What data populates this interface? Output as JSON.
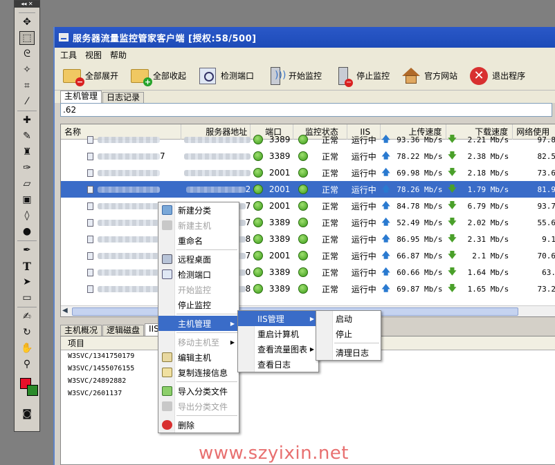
{
  "window": {
    "title": "服务器流量监控管家客户端 [授权:58/500]"
  },
  "menu": {
    "tools": "工具",
    "view": "视图",
    "help": "帮助"
  },
  "toolbar": {
    "expand_all": "全部展开",
    "collapse_all": "全部收起",
    "check_port": "检测端口",
    "start_monitor": "开始监控",
    "stop_monitor": "停止监控",
    "official_site": "官方网站",
    "exit": "退出程序"
  },
  "tabs": {
    "hosts": "主机管理",
    "logs": "日志记录"
  },
  "search": {
    "value": ".62"
  },
  "grid": {
    "columns": [
      "名称",
      "服务器地址",
      "端口",
      "监控状态",
      "IIS",
      "上传速度",
      "下载速度",
      "网络使用"
    ],
    "rows": [
      {
        "name_suffix": "",
        "addr_suffix": "",
        "port": "3389",
        "status": "正常",
        "iis": "运行中",
        "up": "93.36 Mb/s",
        "down": "2.21 Mb/s",
        "net": "97.8"
      },
      {
        "name_suffix": "7",
        "addr_suffix": "",
        "port": "3389",
        "status": "正常",
        "iis": "运行中",
        "up": "78.22 Mb/s",
        "down": "2.38 Mb/s",
        "net": "82.5"
      },
      {
        "name_suffix": "",
        "addr_suffix": "",
        "port": "2001",
        "status": "正常",
        "iis": "运行中",
        "up": "69.98 Mb/s",
        "down": "2.18 Mb/s",
        "net": "73.6"
      },
      {
        "name_suffix": "",
        "addr_suffix": "2",
        "port": "2001",
        "status": "正常",
        "iis": "运行中",
        "up": "78.26 Mb/s",
        "down": "1.79 Mb/s",
        "net": "81.9"
      },
      {
        "name_suffix": "",
        "addr_suffix": "7",
        "port": "2001",
        "status": "正常",
        "iis": "运行中",
        "up": "84.78 Mb/s",
        "down": "6.79 Mb/s",
        "net": "93.7"
      },
      {
        "name_suffix": "",
        "addr_suffix": "7",
        "port": "3389",
        "status": "正常",
        "iis": "运行中",
        "up": "52.49 Mb/s",
        "down": "2.02 Mb/s",
        "net": "55.6"
      },
      {
        "name_suffix": "",
        "addr_suffix": "8",
        "port": "3389",
        "status": "正常",
        "iis": "运行中",
        "up": "86.95 Mb/s",
        "down": "2.31 Mb/s",
        "net": "9.1"
      },
      {
        "name_suffix": "",
        "addr_suffix": "7",
        "port": "2001",
        "status": "正常",
        "iis": "运行中",
        "up": "66.87 Mb/s",
        "down": "2.1 Mb/s",
        "net": "70.6"
      },
      {
        "name_suffix": "",
        "addr_suffix": "0",
        "port": "3389",
        "status": "正常",
        "iis": "运行中",
        "up": "60.66 Mb/s",
        "down": "1.64 Mb/s",
        "net": "63."
      },
      {
        "name_suffix": "",
        "addr_suffix": "8",
        "port": "3389",
        "status": "正常",
        "iis": "运行中",
        "up": "69.87 Mb/s",
        "down": "1.65 Mb/s",
        "net": "73.2"
      }
    ]
  },
  "bottom_tabs": {
    "overview": "主机概况",
    "disk": "逻辑磁盘",
    "iis": "IIS"
  },
  "bottom": {
    "header": "项目",
    "items": [
      "W3SVC/1341750179",
      "W3SVC/1455076155",
      "W3SVC/24892882",
      "W3SVC/2601137"
    ]
  },
  "context_menu": {
    "new_category": "新建分类",
    "new_host": "新建主机",
    "rename": "重命名",
    "remote_desktop": "远程桌面",
    "check_port": "检测端口",
    "start_monitor": "开始监控",
    "stop_monitor": "停止监控",
    "host_mgmt": "主机管理",
    "move_host": "移动主机至",
    "edit_host": "编辑主机",
    "copy_conn": "复制连接信息",
    "import_cat": "导入分类文件",
    "export_cat": "导出分类文件",
    "delete": "删除"
  },
  "host_submenu": {
    "iis_mgmt": "IIS管理",
    "restart": "重启计算机",
    "traffic_chart": "查看流量图表",
    "view_log": "查看日志"
  },
  "iis_submenu": {
    "start": "启动",
    "stop": "停止",
    "clear_log": "清理日志"
  },
  "watermark": "www.szyixin.net"
}
